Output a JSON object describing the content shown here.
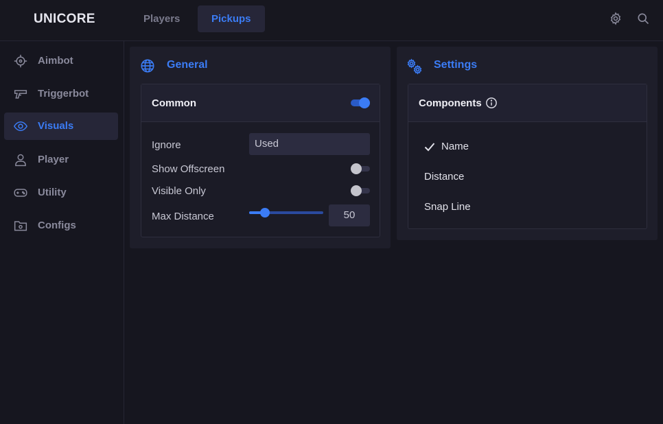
{
  "app": {
    "title": "UNICORE"
  },
  "header": {
    "tabs": [
      {
        "label": "Players",
        "active": false
      },
      {
        "label": "Pickups",
        "active": true
      }
    ],
    "icons": [
      "gear-icon",
      "search-icon"
    ]
  },
  "sidebar": {
    "items": [
      {
        "label": "Aimbot",
        "icon": "crosshair-icon",
        "active": false
      },
      {
        "label": "Triggerbot",
        "icon": "gun-icon",
        "active": false
      },
      {
        "label": "Visuals",
        "icon": "eye-icon",
        "active": true
      },
      {
        "label": "Player",
        "icon": "user-icon",
        "active": false
      },
      {
        "label": "Utility",
        "icon": "gamepad-icon",
        "active": false
      },
      {
        "label": "Configs",
        "icon": "folder-gear-icon",
        "active": false
      }
    ]
  },
  "general": {
    "title": "General",
    "icon": "globe-icon",
    "card": {
      "title": "Common",
      "enabled": true,
      "ignore": {
        "label": "Ignore",
        "value": "Used"
      },
      "show_offscreen": {
        "label": "Show Offscreen",
        "enabled": false
      },
      "visible_only": {
        "label": "Visible Only",
        "enabled": false
      },
      "max_distance": {
        "label": "Max Distance",
        "value": "50",
        "fraction": 0.2
      }
    }
  },
  "settings": {
    "title": "Settings",
    "icon": "gears-icon",
    "card": {
      "title": "Components",
      "info_icon": "info-icon",
      "items": [
        {
          "label": "Name",
          "checked": true
        },
        {
          "label": "Distance",
          "checked": false
        },
        {
          "label": "Snap Line",
          "checked": false
        }
      ]
    }
  },
  "colors": {
    "accent": "#3b7cf5",
    "background": "#16161f",
    "panel": "#1e1e2a"
  }
}
